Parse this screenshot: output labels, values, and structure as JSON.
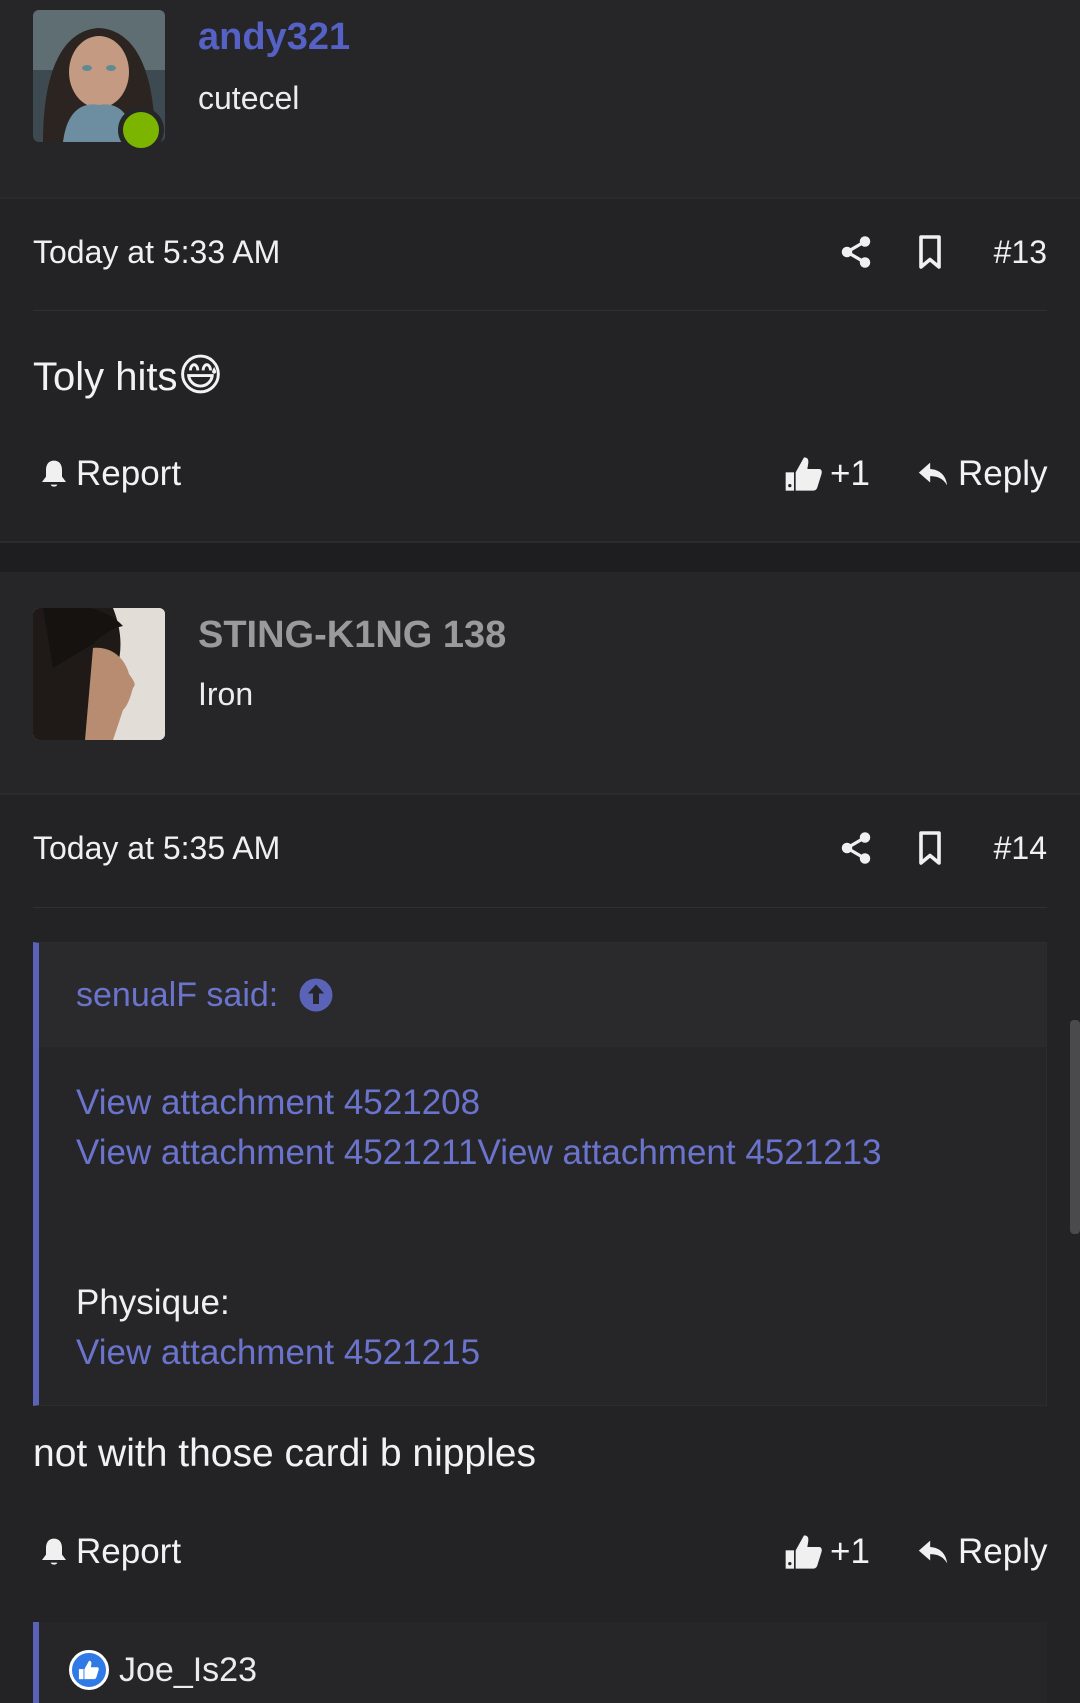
{
  "posts": [
    {
      "username": "andy321",
      "user_title": "cutecel",
      "timestamp": "Today at 5:33 AM",
      "post_number": "#13",
      "body": "Toly hits",
      "emoji": "😅",
      "report_label": "Report",
      "like_label": "+1",
      "reply_label": "Reply",
      "username_color": "#5561c4",
      "online": true
    },
    {
      "username": "STING-K1NG 138",
      "user_title": "Iron",
      "timestamp": "Today at 5:35 AM",
      "post_number": "#14",
      "quote": {
        "author": "senualF said:",
        "links": [
          "View attachment 4521208",
          "View attachment 4521211",
          "View attachment 4521213"
        ],
        "physique_label": "Physique:",
        "physique_link": "View attachment 4521215"
      },
      "body": "not with those cardi b nipples",
      "report_label": "Report",
      "like_label": "+1",
      "reply_label": "Reply",
      "username_color": "#9a9a9a"
    }
  ],
  "reactions": {
    "users": "Joe_Is23"
  },
  "icons": [
    "share-icon",
    "bookmark-icon",
    "bell-icon",
    "thumbs-up-icon",
    "reply-icon",
    "arrow-up-circle-icon"
  ]
}
